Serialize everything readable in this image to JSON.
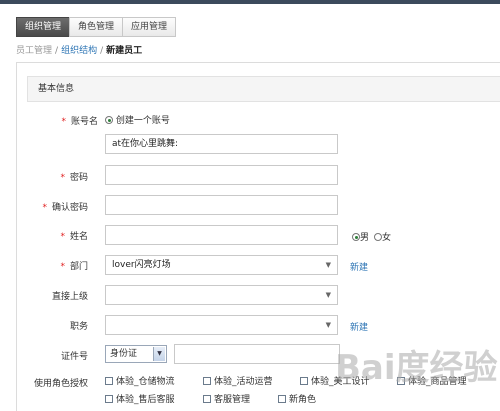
{
  "tabs": [
    {
      "label": "组织管理",
      "active": true
    },
    {
      "label": "角色管理",
      "active": false
    },
    {
      "label": "应用管理",
      "active": false
    }
  ],
  "breadcrumb": {
    "item1": "员工管理",
    "item2": "组织结构",
    "current": "新建员工",
    "separator": "/"
  },
  "panel": {
    "title": "基本信息"
  },
  "form": {
    "account": {
      "label": "账号名",
      "radio_label": "创建一个账号",
      "value": "at在你心里跳舞:"
    },
    "password": {
      "label": "密码",
      "value": ""
    },
    "confirm_password": {
      "label": "确认密码",
      "value": ""
    },
    "name": {
      "label": "姓名",
      "value": "",
      "gender_male": "男",
      "gender_female": "女",
      "gender_selected": "男"
    },
    "department": {
      "label": "部门",
      "value": "lover闪亮灯场",
      "new_link": "新建"
    },
    "supervisor": {
      "label": "直接上级",
      "value": ""
    },
    "position": {
      "label": "职务",
      "value": "",
      "new_link": "新建"
    },
    "id_number": {
      "label": "证件号",
      "id_type": "身份证",
      "value": ""
    },
    "roles": {
      "label": "使用角色授权",
      "options": [
        "体验_仓储物流",
        "体验_活动运营",
        "体验_美工设计",
        "体验_商品管理",
        "体验_售后客服",
        "客服管理",
        "新角色"
      ]
    }
  },
  "watermark": {
    "text": "Bai度经验"
  },
  "colors": {
    "link": "#2f76b5",
    "required": "#e02020",
    "tab_active": "#4a4a4a"
  }
}
